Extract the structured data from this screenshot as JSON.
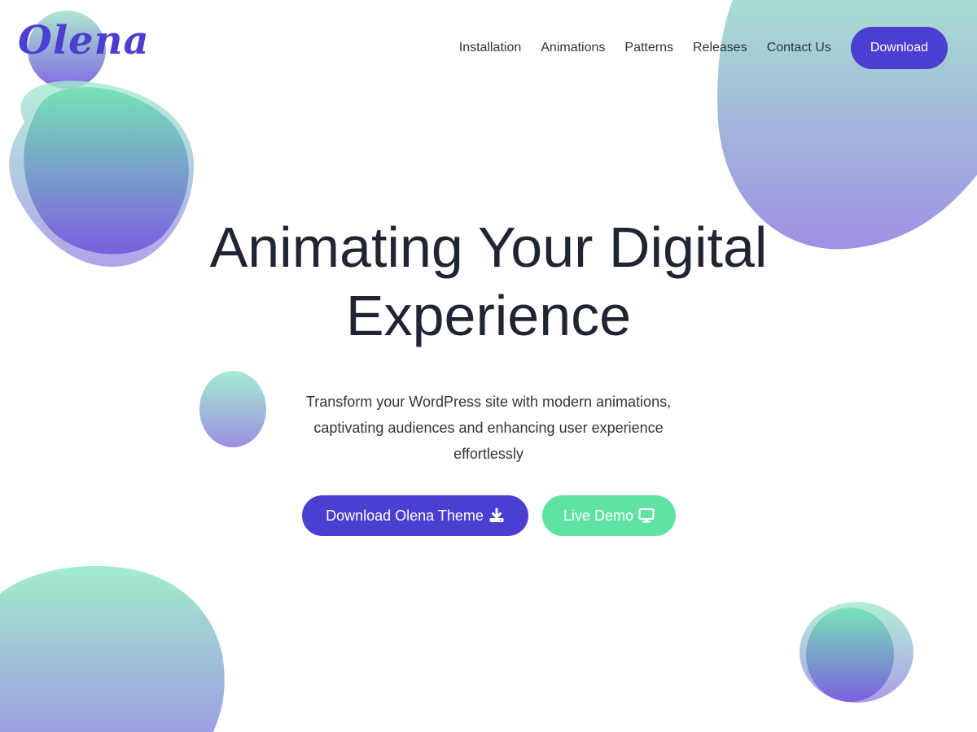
{
  "brand": {
    "logo": "Olena",
    "primary_color": "#4b3fd1",
    "accent_color": "#5fe3a4"
  },
  "nav": {
    "items": [
      {
        "label": "Installation"
      },
      {
        "label": "Animations"
      },
      {
        "label": "Patterns"
      },
      {
        "label": "Releases"
      },
      {
        "label": "Contact Us"
      }
    ],
    "download_label": "Download"
  },
  "hero": {
    "title_line1": "Animating Your Digital",
    "title_line2": "Experience",
    "subtitle_line1": "Transform your WordPress site with modern animations,",
    "subtitle_line2": "captivating audiences and enhancing user experience",
    "subtitle_line3": "effortlessly",
    "cta_primary": {
      "label": "Download Olena Theme",
      "icon": "download-icon"
    },
    "cta_secondary": {
      "label": "Live Demo",
      "icon": "monitor-icon"
    }
  }
}
